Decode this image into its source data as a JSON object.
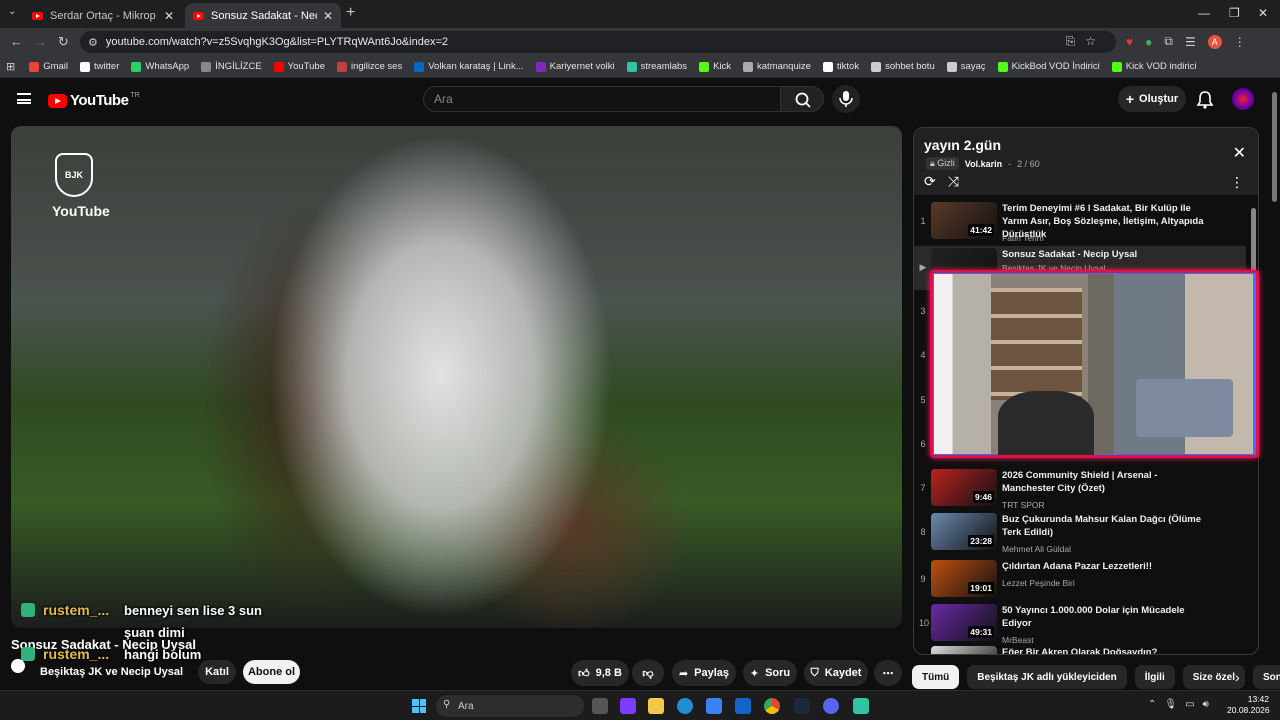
{
  "browser": {
    "tabs": [
      {
        "title": "Serdar Ortaç - Mikrop - YouTube"
      },
      {
        "title": "Sonsuz Sadakat - Necip Uysal"
      }
    ],
    "url": "youtube.com/watch?v=z5SvqhgK3Og&list=PLYTRqWAnt6Jo&index=2",
    "profile_initial": "A",
    "bookmarks": [
      {
        "label": "Gmail",
        "color": "#ea4335"
      },
      {
        "label": "twitter",
        "color": "#ffffff"
      },
      {
        "label": "WhatsApp",
        "color": "#25d366"
      },
      {
        "label": "İNGİLİZCE",
        "color": "#888888"
      },
      {
        "label": "YouTube",
        "color": "#ff0000"
      },
      {
        "label": "ingilizce ses",
        "color": "#c04040"
      },
      {
        "label": "Volkan karataş | Link...",
        "color": "#0a66c2"
      },
      {
        "label": "Kariyernet volki",
        "color": "#7b2cbf"
      },
      {
        "label": "streamlabs",
        "color": "#31c3a2"
      },
      {
        "label": "Kick",
        "color": "#53fc18"
      },
      {
        "label": "katmanquize",
        "color": "#aaaaaa"
      },
      {
        "label": "tiktok",
        "color": "#ffffff"
      },
      {
        "label": "sohbet botu",
        "color": "#cccccc"
      },
      {
        "label": "sayaç",
        "color": "#cccccc"
      },
      {
        "label": "KickBod VOD İndirici",
        "color": "#53fc18"
      },
      {
        "label": "Kick VOD indirici",
        "color": "#53fc18"
      }
    ]
  },
  "youtube": {
    "logo_text": "YouTube",
    "country": "TR",
    "search_placeholder": "Ara",
    "create_label": "Oluştur"
  },
  "video": {
    "overlay_logo_text": "YouTube",
    "crest_text": "BJK",
    "title": "Sonsuz Sadakat - Necip Uysal",
    "channel": "Beşiktaş JK ve Necip Uysal",
    "join_label": "Katıl",
    "subscribe_label": "Abone ol",
    "likes": "9,8 B",
    "share_label": "Paylaş",
    "ask_label": "Soru",
    "save_label": "Kaydet"
  },
  "chat": [
    {
      "user": "rustem_...",
      "message": "benneyi sen lise 3 sun"
    },
    {
      "user": "",
      "message": "şuan dimi"
    },
    {
      "user": "rustem_...",
      "message": "hangi bolum"
    }
  ],
  "playlist": {
    "title": "yayın 2.gün",
    "privacy": "Gizli",
    "owner": "Vol.karin",
    "position": "2 / 60",
    "items": [
      {
        "num": "1",
        "title": "Terim Deneyimi #6 l Sadakat, Bir Kulüp ile Yarım Asır, Boş Sözleşme, İletişim, Altyapıda Dürüstlük",
        "channel": "Fatih Terim",
        "duration": "41:42"
      },
      {
        "num": "▶",
        "title": "Sonsuz Sadakat - Necip Uysal",
        "channel": "Beşiktaş JK ve Necip Uysal",
        "duration": ""
      },
      {
        "num": "3"
      },
      {
        "num": "4"
      },
      {
        "num": "5"
      },
      {
        "num": "6"
      },
      {
        "num": "7",
        "title": "2026 Community Shield | Arsenal - Manchester City (Özet)",
        "channel": "TRT SPOR",
        "duration": "9:46"
      },
      {
        "num": "8",
        "title": "Buz Çukurunda Mahsur Kalan Dağcı (Ölüme Terk Edildi)",
        "channel": "Mehmet Ali Güldal",
        "duration": "23:28"
      },
      {
        "num": "9",
        "title": "Çıldırtan Adana Pazar Lezzetleri!!",
        "channel": "Lezzet Peşinde Biri",
        "duration": "19:01"
      },
      {
        "num": "10",
        "title": "50 Yayıncı 1.000.000 Dolar için Mücadele Ediyor",
        "channel": "MrBeast",
        "duration": "49:31"
      },
      {
        "num": "",
        "title": "Eğer Bir Akrep Olarak Doğsaydın?",
        "channel": "",
        "duration": ""
      }
    ]
  },
  "chips": [
    "Tümü",
    "Beşiktaş JK adlı yükleyiciden",
    "İlgili",
    "Size özel",
    "Son"
  ],
  "taskbar": {
    "search_placeholder": "Ara",
    "time": "13:42",
    "date": "20.08.2026"
  }
}
